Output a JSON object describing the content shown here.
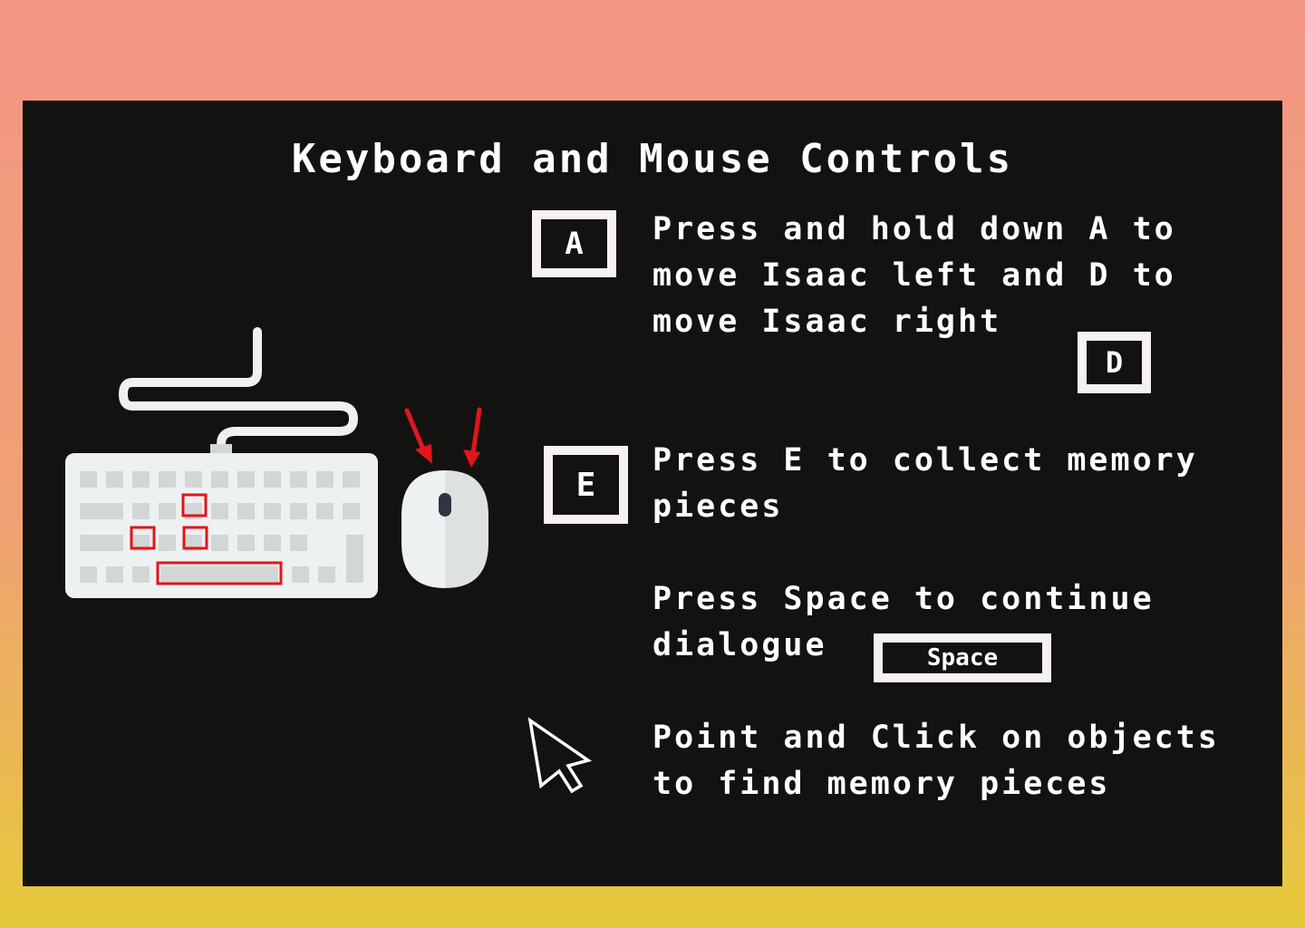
{
  "title": "Keyboard and Mouse Controls",
  "instructions": [
    {
      "text": "Press and hold down A to\nmove Isaac left and D to\nmove Isaac right"
    },
    {
      "text": "Press E to collect memory\npieces"
    },
    {
      "text": "Press Space to continue\ndialogue"
    },
    {
      "text": "Point and Click on objects\nto find memory pieces"
    }
  ],
  "keys": {
    "a": "A",
    "d": "D",
    "e": "E",
    "space": "Space"
  },
  "icons": {
    "illustration": "keyboard-and-mouse-icon",
    "cursor": "mouse-pointer-icon"
  },
  "colors": {
    "panel": "#121211",
    "key_border": "#f7f1f1",
    "highlight": "#e0161b",
    "device": "#eef1f1",
    "device_keys": "#d3d6d6"
  }
}
